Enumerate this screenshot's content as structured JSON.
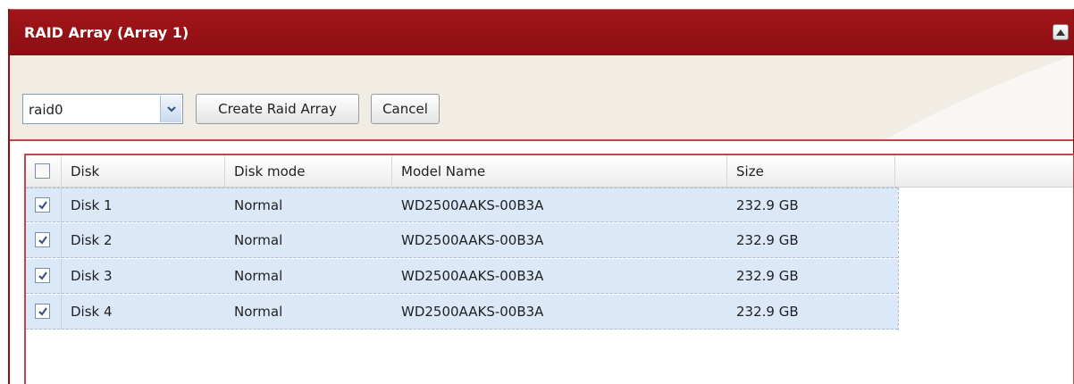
{
  "panel": {
    "title": "RAID Array (Array 1)"
  },
  "toolbar": {
    "raid_level": "raid0",
    "create_label": "Create Raid Array",
    "cancel_label": "Cancel"
  },
  "grid": {
    "columns": [
      "Disk",
      "Disk mode",
      "Model Name",
      "Size"
    ],
    "select_all_checked": false,
    "rows": [
      {
        "checked": true,
        "disk": "Disk 1",
        "mode": "Normal",
        "model": "WD2500AAKS-00B3A",
        "size": "232.9 GB"
      },
      {
        "checked": true,
        "disk": "Disk 2",
        "mode": "Normal",
        "model": "WD2500AAKS-00B3A",
        "size": "232.9 GB"
      },
      {
        "checked": true,
        "disk": "Disk 3",
        "mode": "Normal",
        "model": "WD2500AAKS-00B3A",
        "size": "232.9 GB"
      },
      {
        "checked": true,
        "disk": "Disk 4",
        "mode": "Normal",
        "model": "WD2500AAKS-00B3A",
        "size": "232.9 GB"
      }
    ]
  },
  "colors": {
    "title_bar": "#8a0f13",
    "accent_border": "#c7454a",
    "row_selected": "#dbe8f8"
  },
  "icons": {
    "collapse": "collapse-up-icon",
    "dropdown": "chevron-down-icon",
    "check": "checkmark-icon"
  }
}
